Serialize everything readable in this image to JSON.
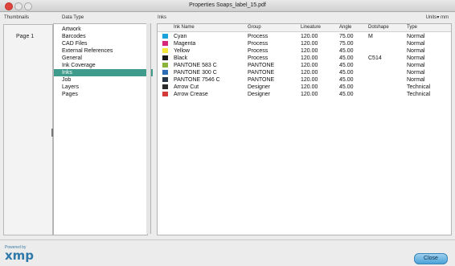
{
  "window": {
    "title": "Properties Soaps_label_15.pdf"
  },
  "columns": {
    "thumbnails": "Thumbnails",
    "data_type": "Data Type",
    "inks": "Inks"
  },
  "units": {
    "label": "Units",
    "value": "mm"
  },
  "thumbnails": {
    "page_label": "Page 1"
  },
  "data_types": [
    "Artwork",
    "Barcodes",
    "CAD Files",
    "External References",
    "General",
    "Ink Coverage",
    "Inks",
    "Job",
    "Layers",
    "Pages"
  ],
  "selected_data_type": "Inks",
  "inks_table": {
    "headers": [
      "Ink Name",
      "Group",
      "Lineature",
      "Angle",
      "Dotshape",
      "Type"
    ],
    "rows": [
      {
        "name": "Cyan",
        "group": "Process",
        "lineature": "120.00",
        "angle": "75.00",
        "dotshape": "M",
        "type": "Normal",
        "color": "#1aa3d8"
      },
      {
        "name": "Magenta",
        "group": "Process",
        "lineature": "120.00",
        "angle": "75.00",
        "dotshape": "",
        "type": "Normal",
        "color": "#d6287a"
      },
      {
        "name": "Yellow",
        "group": "Process",
        "lineature": "120.00",
        "angle": "45.00",
        "dotshape": "",
        "type": "Normal",
        "color": "#f3e53a"
      },
      {
        "name": "Black",
        "group": "Process",
        "lineature": "120.00",
        "angle": "45.00",
        "dotshape": "C514",
        "type": "Normal",
        "color": "#1a1a1a"
      },
      {
        "name": "PANTONE 583 C",
        "group": "PANTONE",
        "lineature": "120.00",
        "angle": "45.00",
        "dotshape": "",
        "type": "Normal",
        "color": "#8bb33a"
      },
      {
        "name": "PANTONE 300 C",
        "group": "PANTONE",
        "lineature": "120.00",
        "angle": "45.00",
        "dotshape": "",
        "type": "Normal",
        "color": "#2a6db5"
      },
      {
        "name": "PANTONE 7546 C",
        "group": "PANTONE",
        "lineature": "120.00",
        "angle": "45.00",
        "dotshape": "",
        "type": "Normal",
        "color": "#263645"
      },
      {
        "name": "Arrow Cut",
        "group": "Designer",
        "lineature": "120.00",
        "angle": "45.00",
        "dotshape": "",
        "type": "Technical",
        "color": "#2b2b2b"
      },
      {
        "name": "Arrow Crease",
        "group": "Designer",
        "lineature": "120.00",
        "angle": "45.00",
        "dotshape": "",
        "type": "Technical",
        "color": "#d33b3b"
      }
    ]
  },
  "footer": {
    "powered_by": "Powered by",
    "brand": "xmp",
    "close_label": "Close"
  }
}
